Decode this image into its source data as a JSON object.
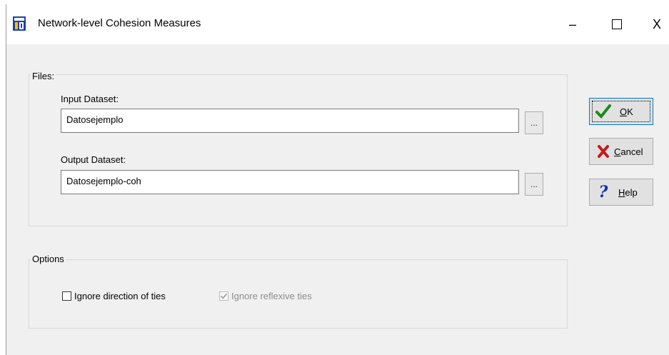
{
  "window": {
    "title": "Network-level Cohesion Measures",
    "controls": {
      "minimize": "–",
      "maximize": "□",
      "close": "X"
    }
  },
  "files": {
    "group_label": "Files:",
    "input_label": "Input Dataset:",
    "input_value": "Datosejemplo",
    "output_label": "Output Dataset:",
    "output_value": "Datosejemplo-coh",
    "browse_label": "..."
  },
  "options": {
    "group_label": "Options",
    "ignore_direction": {
      "label": "Ignore direction of ties",
      "checked": false
    },
    "ignore_reflexive": {
      "label": "Ignore reflexive ties",
      "checked": true,
      "disabled": true
    }
  },
  "buttons": {
    "ok": {
      "mnemonic": "O",
      "rest": "K",
      "icon": "checkmark-icon"
    },
    "cancel": {
      "mnemonic": "C",
      "rest": "ancel",
      "icon": "x-icon"
    },
    "help": {
      "mnemonic": "H",
      "rest": "elp",
      "icon": "question-icon"
    }
  },
  "colors": {
    "ok_icon": "#1a8a1a",
    "cancel_icon": "#c81818",
    "help_icon": "#1030b0",
    "window_bg": "#f0f0f0"
  }
}
